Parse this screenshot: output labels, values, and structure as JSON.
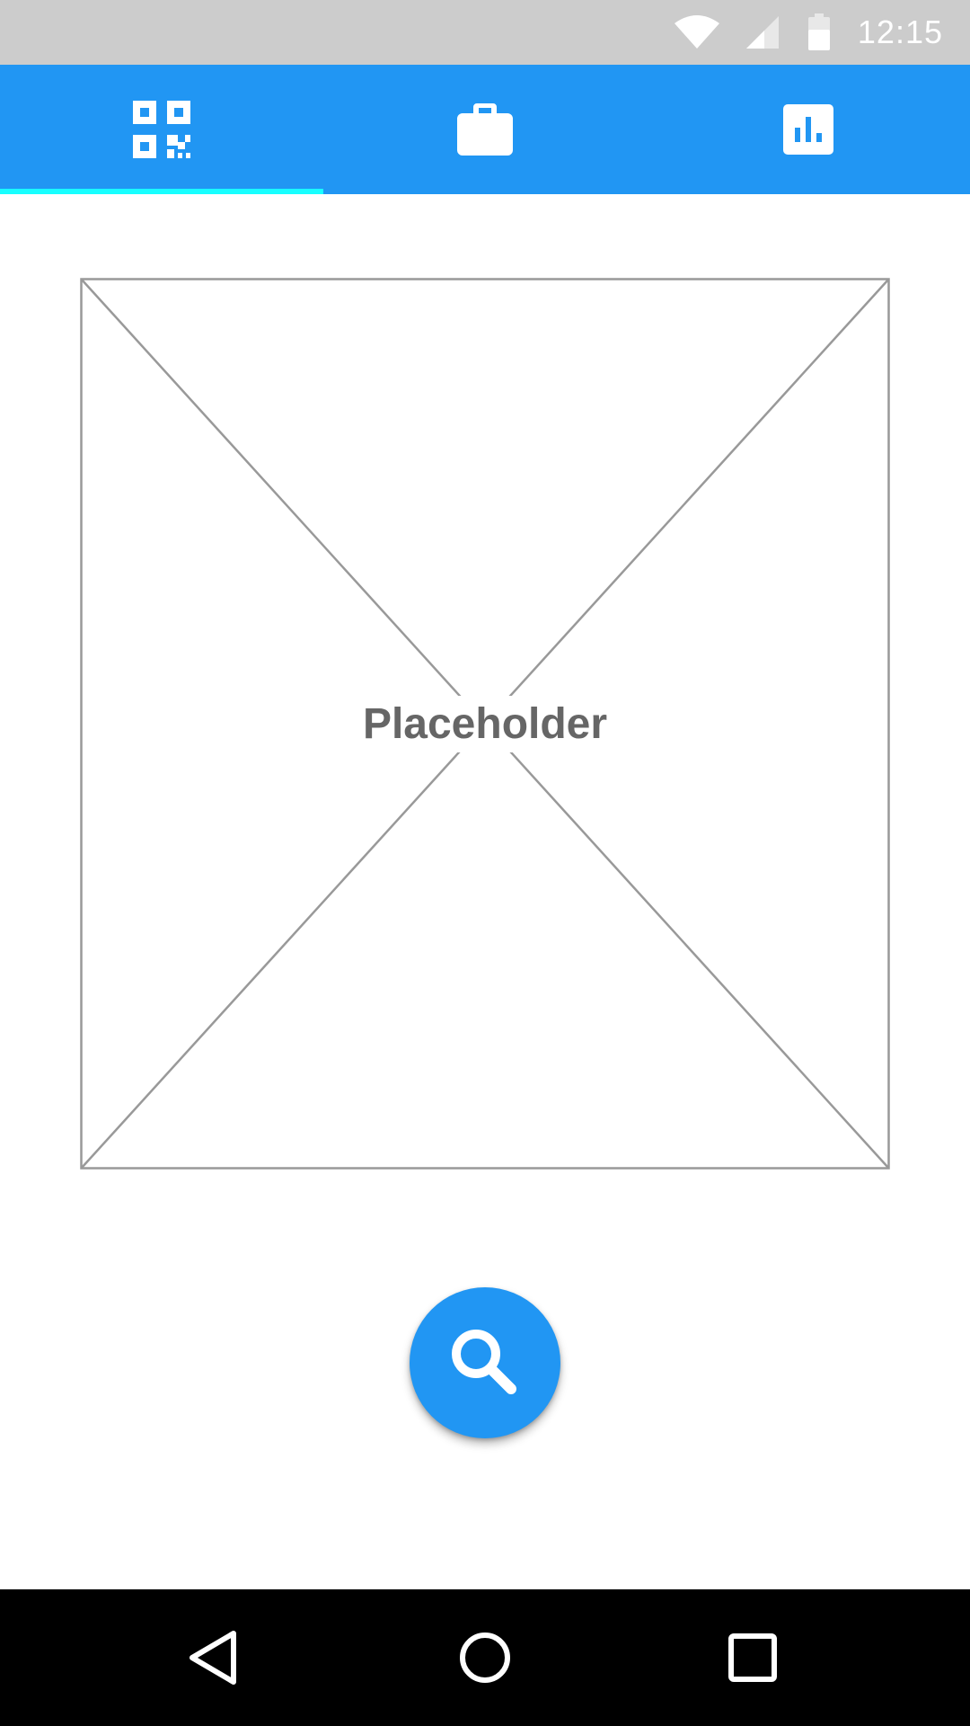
{
  "status_bar": {
    "time": "12:15",
    "icons": [
      "wifi-icon",
      "signal-icon",
      "battery-icon"
    ]
  },
  "tabs": [
    {
      "icon": "qr-code-icon",
      "selected": true
    },
    {
      "icon": "briefcase-icon",
      "selected": false
    },
    {
      "icon": "bar-chart-icon",
      "selected": false
    }
  ],
  "placeholder": {
    "label": "Placeholder"
  },
  "fab": {
    "icon": "search-icon"
  },
  "nav_bar": {
    "buttons": [
      "back-icon",
      "home-icon",
      "recents-icon"
    ]
  },
  "colors": {
    "primary": "#2196f3",
    "tab_indicator": "#18ffff",
    "status_bar": "#cccccc",
    "nav_bar": "#000000",
    "placeholder_stroke": "#999999",
    "placeholder_text": "#666666"
  }
}
